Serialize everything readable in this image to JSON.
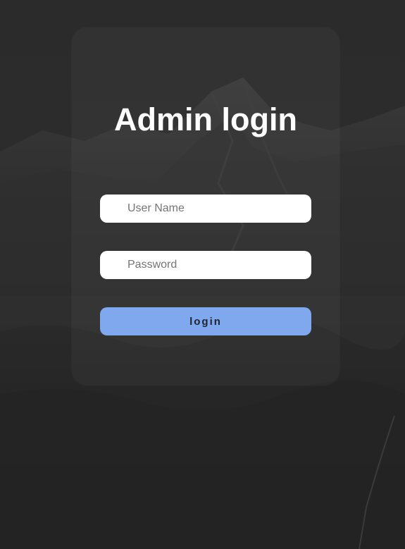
{
  "page": {
    "title": "Admin login"
  },
  "form": {
    "username_placeholder": "User Name",
    "username_value": "",
    "password_placeholder": "Password",
    "password_value": "",
    "submit_label": "login"
  },
  "colors": {
    "background": "#2a2a2a",
    "card": "#333333",
    "input": "#ffffff",
    "button": "#7fa8ee",
    "button_text": "#1f2430",
    "title": "#ffffff"
  }
}
